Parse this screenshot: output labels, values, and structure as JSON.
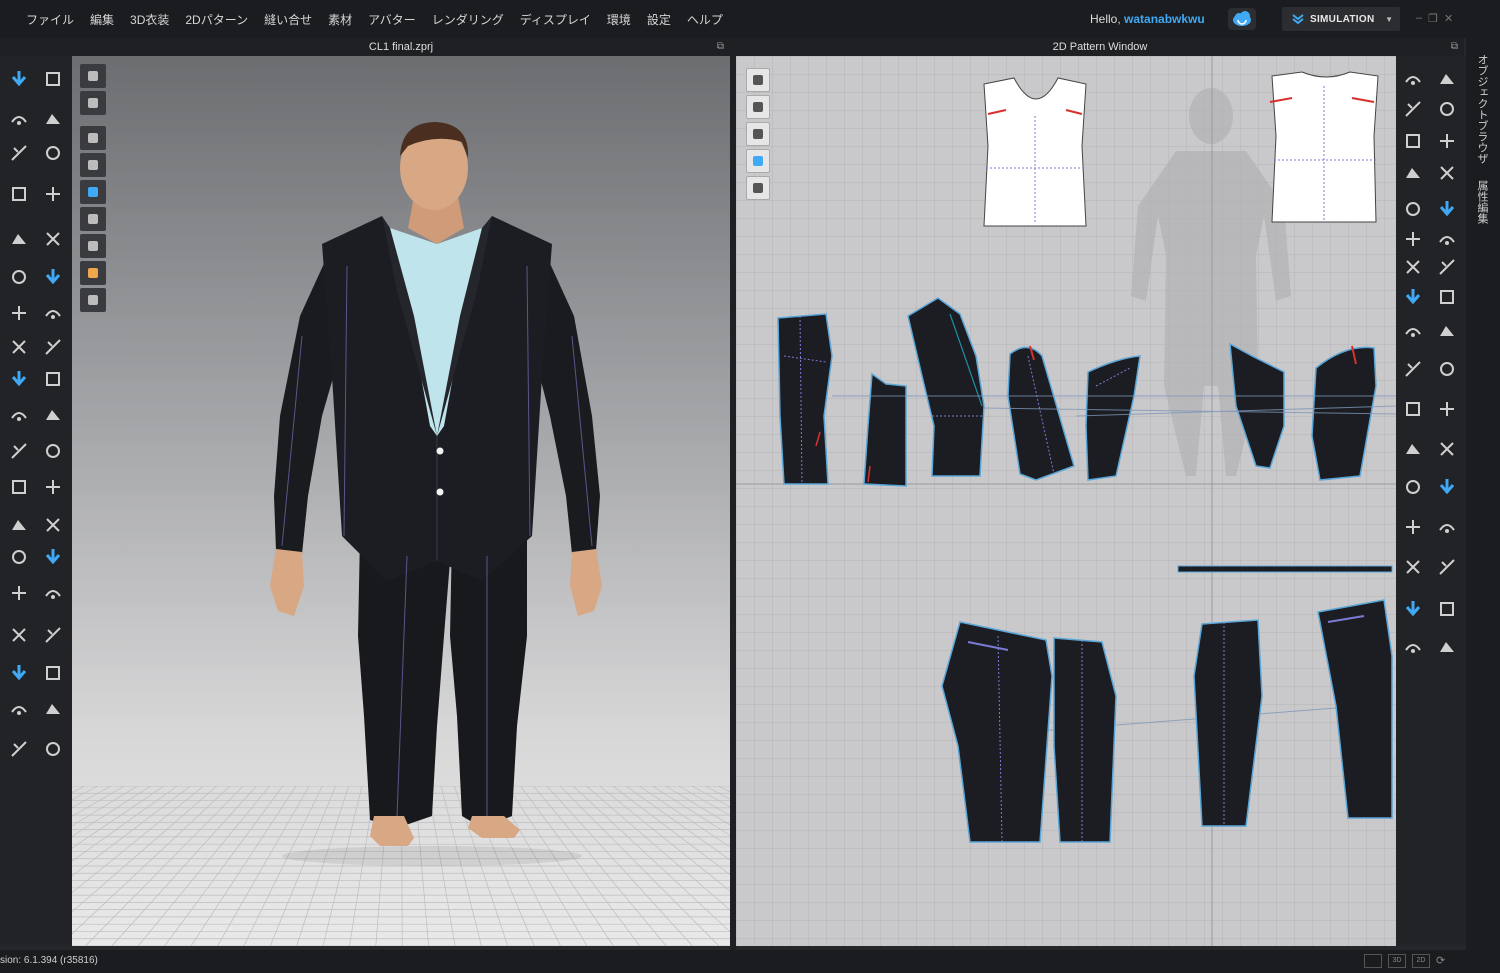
{
  "menu": [
    "ファイル",
    "編集",
    "3D衣装",
    "2Dパターン",
    "縫い合せ",
    "素材",
    "アバター",
    "レンダリング",
    "ディスプレイ",
    "環境",
    "設定",
    "ヘルプ"
  ],
  "user": {
    "greeting": "Hello, ",
    "name": "watanabwkwu"
  },
  "simulation_button": "SIMULATION",
  "viewport3d": {
    "title": "CL1 final.zprj"
  },
  "pattern2d": {
    "title": "2D Pattern Window"
  },
  "side_tabs": [
    "オブジェクトブラウザ",
    "属性編集"
  ],
  "status": {
    "version": "sion: 6.1.394 (r35816)",
    "view_buttons": [
      "3D",
      "2D"
    ]
  },
  "colors": {
    "accent": "#3fa9f5",
    "garment": "#1c1d22",
    "pattern_outline": "#5aa6d8",
    "stitch_red": "#d9302c"
  }
}
